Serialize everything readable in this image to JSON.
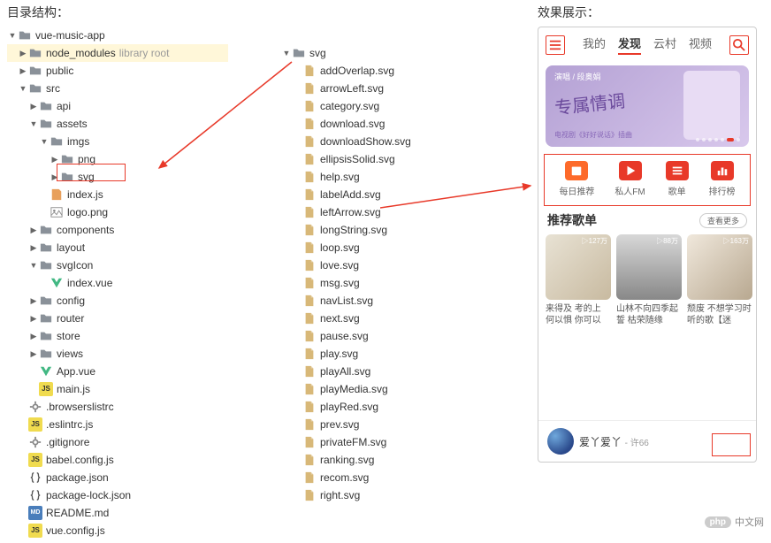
{
  "labels": {
    "structure": "目录结构：",
    "preview": "效果展示："
  },
  "tree_left": [
    {
      "depth": 0,
      "arrow": "down",
      "icon": "folder",
      "label": "vue-music-app",
      "hl": false
    },
    {
      "depth": 1,
      "arrow": "right",
      "icon": "folder",
      "label": "node_modules",
      "suffix": "library root",
      "hl": true
    },
    {
      "depth": 1,
      "arrow": "right",
      "icon": "folder",
      "label": "public",
      "hl": false
    },
    {
      "depth": 1,
      "arrow": "down",
      "icon": "folder",
      "label": "src",
      "hl": false
    },
    {
      "depth": 2,
      "arrow": "right",
      "icon": "folder",
      "label": "api",
      "hl": false
    },
    {
      "depth": 2,
      "arrow": "down",
      "icon": "folder",
      "label": "assets",
      "hl": false
    },
    {
      "depth": 3,
      "arrow": "down",
      "icon": "folder",
      "label": "imgs",
      "hl": false
    },
    {
      "depth": 4,
      "arrow": "right",
      "icon": "folder",
      "label": "png",
      "hl": false
    },
    {
      "depth": 4,
      "arrow": "right",
      "icon": "folder",
      "label": "svg",
      "hl": false,
      "boxed": true
    },
    {
      "depth": 3,
      "arrow": "",
      "icon": "html",
      "label": "index.js",
      "hl": false
    },
    {
      "depth": 3,
      "arrow": "",
      "icon": "img",
      "label": "logo.png",
      "hl": false
    },
    {
      "depth": 2,
      "arrow": "right",
      "icon": "folder",
      "label": "components",
      "hl": false
    },
    {
      "depth": 2,
      "arrow": "right",
      "icon": "folder",
      "label": "layout",
      "hl": false
    },
    {
      "depth": 2,
      "arrow": "down",
      "icon": "folder",
      "label": "svgIcon",
      "hl": false
    },
    {
      "depth": 3,
      "arrow": "",
      "icon": "vue",
      "label": "index.vue",
      "hl": false
    },
    {
      "depth": 2,
      "arrow": "right",
      "icon": "folder",
      "label": "config",
      "hl": false
    },
    {
      "depth": 2,
      "arrow": "right",
      "icon": "folder",
      "label": "router",
      "hl": false
    },
    {
      "depth": 2,
      "arrow": "right",
      "icon": "folder",
      "label": "store",
      "hl": false
    },
    {
      "depth": 2,
      "arrow": "right",
      "icon": "folder",
      "label": "views",
      "hl": false
    },
    {
      "depth": 2,
      "arrow": "",
      "icon": "vue",
      "label": "App.vue",
      "hl": false
    },
    {
      "depth": 2,
      "arrow": "",
      "icon": "js",
      "label": "main.js",
      "hl": false
    },
    {
      "depth": 1,
      "arrow": "",
      "icon": "config",
      "label": ".browserslistrc",
      "hl": false
    },
    {
      "depth": 1,
      "arrow": "",
      "icon": "js",
      "label": ".eslintrc.js",
      "hl": false
    },
    {
      "depth": 1,
      "arrow": "",
      "icon": "config",
      "label": ".gitignore",
      "hl": false
    },
    {
      "depth": 1,
      "arrow": "",
      "icon": "js",
      "label": "babel.config.js",
      "hl": false
    },
    {
      "depth": 1,
      "arrow": "",
      "icon": "json",
      "label": "package.json",
      "hl": false
    },
    {
      "depth": 1,
      "arrow": "",
      "icon": "json",
      "label": "package-lock.json",
      "hl": false
    },
    {
      "depth": 1,
      "arrow": "",
      "icon": "md",
      "label": "README.md",
      "hl": false
    },
    {
      "depth": 1,
      "arrow": "",
      "icon": "js",
      "label": "vue.config.js",
      "hl": false
    }
  ],
  "tree_mid_root": {
    "depth": 0,
    "arrow": "down",
    "icon": "folder",
    "label": "svg"
  },
  "tree_mid": [
    "addOverlap.svg",
    "arrowLeft.svg",
    "category.svg",
    "download.svg",
    "downloadShow.svg",
    "ellipsisSolid.svg",
    "help.svg",
    "labelAdd.svg",
    "leftArrow.svg",
    "longString.svg",
    "loop.svg",
    "love.svg",
    "msg.svg",
    "navList.svg",
    "next.svg",
    "pause.svg",
    "play.svg",
    "playAll.svg",
    "playMedia.svg",
    "playRed.svg",
    "prev.svg",
    "privateFM.svg",
    "ranking.svg",
    "recom.svg",
    "right.svg"
  ],
  "phone": {
    "nav": {
      "t0": "我的",
      "t1": "发现",
      "t2": "云村",
      "t3": "视频",
      "active": 1
    },
    "banner": {
      "top": "演唱 / 段奥娟",
      "title": "专属情调",
      "sub": "电视剧《好好说话》插曲"
    },
    "cats": [
      {
        "label": "每日推荐",
        "color": "orange",
        "icon": "calendar"
      },
      {
        "label": "私人FM",
        "color": "red",
        "icon": "play"
      },
      {
        "label": "歌单",
        "color": "red",
        "icon": "list"
      },
      {
        "label": "排行榜",
        "color": "red",
        "icon": "rank"
      }
    ],
    "section_title": "推荐歌单",
    "view_more": "查看更多",
    "albums": [
      {
        "plays": "▷127万",
        "title": "来得及 考的上 何以惧 你可以",
        "bg": "linear-gradient(135deg,#e8e2d4,#c8baa0)"
      },
      {
        "plays": "▷88万",
        "title": "山林不向四季起誓 枯荣随缘",
        "bg": "linear-gradient(180deg,#d8d8d8,#888)"
      },
      {
        "plays": "▷163万",
        "title": "颓废 不想学习时听的歌【迷",
        "bg": "linear-gradient(135deg,#f0e8dc,#b8a890)"
      }
    ],
    "track": {
      "name": "爱丫爱丫",
      "artist": "许66"
    }
  },
  "watermark": {
    "badge": "php",
    "text": "中文网"
  }
}
